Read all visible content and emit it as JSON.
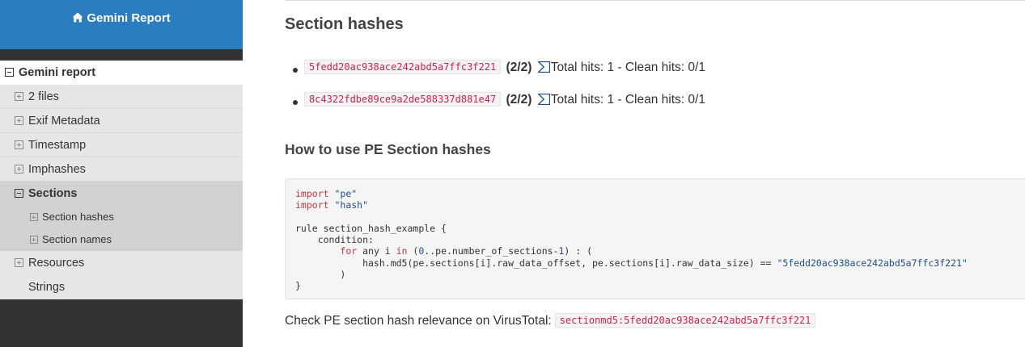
{
  "brand": {
    "title": "Gemini Report",
    "icon": "home-icon"
  },
  "nav": {
    "root": "Gemini report",
    "items": [
      {
        "label": "2 files"
      },
      {
        "label": "Exif Metadata"
      },
      {
        "label": "Timestamp"
      },
      {
        "label": "Imphashes"
      },
      {
        "label": "Sections"
      },
      {
        "label": "Section hashes"
      },
      {
        "label": "Section names"
      },
      {
        "label": "Resources"
      },
      {
        "label": "Strings"
      }
    ]
  },
  "main": {
    "title": "Section hashes",
    "hashes": [
      {
        "hash": "5fedd20ac938ace242abd5a7ffc3f221",
        "ratio": "(2/2)",
        "summary": "Total hits: 1 - Clean hits: 0/1"
      },
      {
        "hash": "8c4322fdbe89ce9a2de588337d881e47",
        "ratio": "(2/2)",
        "summary": "Total hits: 1 - Clean hits: 0/1"
      }
    ],
    "howto_title": "How to use PE Section hashes",
    "code": {
      "l1_kw": "import",
      "l1_str": "\"pe\"",
      "l2_kw": "import",
      "l2_str": "\"hash\"",
      "l4": "rule section_hash_example {",
      "l5": "    condition:",
      "l6_indent": "        ",
      "l6_kw": "for",
      "l6_a": " any i ",
      "l6_in": "in",
      "l6_b": " (",
      "l6_n0": "0",
      "l6_c": "..pe.number_of_sections-",
      "l6_n1": "1",
      "l6_d": ") : (",
      "l7_a": "            hash.md5(pe.sections[i].raw_data_offset, pe.sections[i].raw_data_size) == ",
      "l7_str": "\"5fedd20ac938ace242abd5a7ffc3f221\"",
      "l8": "        )",
      "l9": "}"
    },
    "check_text": "Check PE section hash relevance on VirusTotal:",
    "check_query": "sectionmd5:5fedd20ac938ace242abd5a7ffc3f221"
  },
  "colors": {
    "brand_blue": "#2c7cc0",
    "sidebar_dark": "#333333",
    "code_red": "#c7254e",
    "link_blue": "#1f4f8c"
  }
}
